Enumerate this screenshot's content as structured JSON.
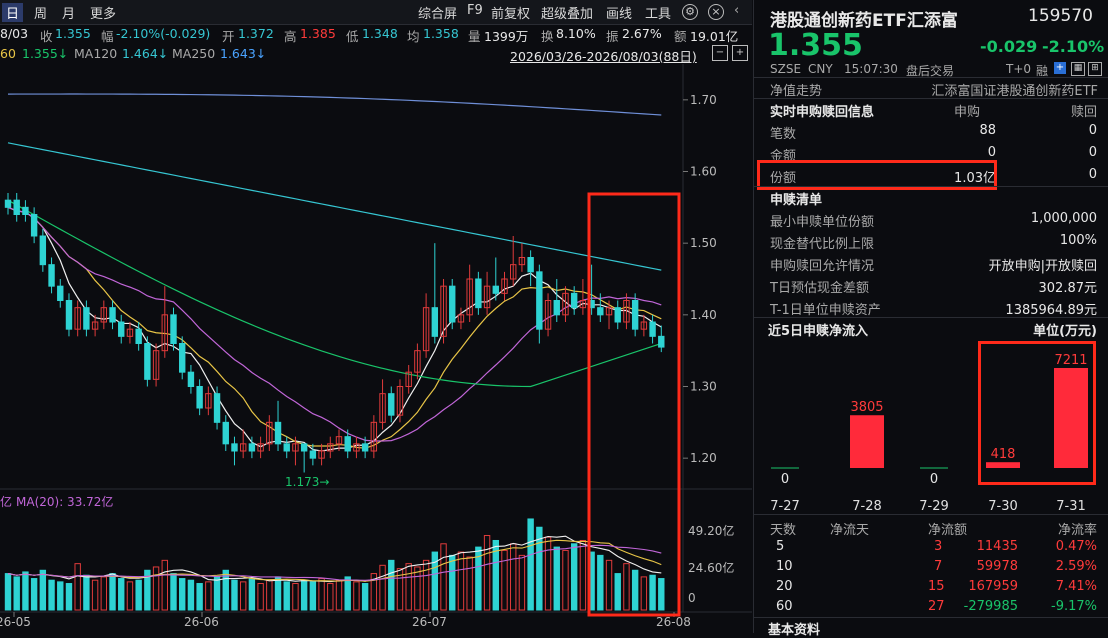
{
  "toolbar": {
    "period_day": "日",
    "period_week": "周",
    "period_month": "月",
    "more": "更多",
    "composite": "综合屏",
    "f9": "F9",
    "adjust": "前复权",
    "overlay": "超级叠加",
    "draw": "画线",
    "tools": "工具"
  },
  "infobar": {
    "date": "8/03",
    "close_label": "收",
    "close": "1.355",
    "change_label": "幅",
    "change": "-2.10%(-0.029)",
    "open_label": "开",
    "open": "1.372",
    "high_label": "高",
    "high": "1.385",
    "low_label": "低",
    "low": "1.348",
    "avg_label": "均",
    "avg": "1.358",
    "volume_label": "量",
    "volume": "1399万",
    "turnover_label": "换",
    "turnover": "8.10%",
    "amplitude_label": "振",
    "amplitude": "2.67%",
    "amount_label": "额",
    "amount": "19.01亿"
  },
  "mabar": {
    "ma60_prefix": "60",
    "ma60": "1.355↓",
    "ma120_label": "MA120",
    "ma120": "1.464↓",
    "ma250_label": "MA250",
    "ma250": "1.643↓",
    "range": "2026/03/26-2026/08/03(88日)"
  },
  "chart_data": {
    "type": "candlestick",
    "price_axis": [
      "1.70",
      "1.60",
      "1.50",
      "1.40",
      "1.30",
      "1.20"
    ],
    "low_marker": "1.173",
    "volume_label": "亿",
    "volume_ma": "MA(20): 33.72亿",
    "volume_axis": [
      "49.20亿",
      "24.60亿",
      "0"
    ],
    "x_labels": [
      "26-05",
      "26-06",
      "26-07",
      "26-08"
    ],
    "candles": [
      {
        "o": 1.56,
        "c": 1.55,
        "h": 1.57,
        "l": 1.54
      },
      {
        "o": 1.56,
        "c": 1.54,
        "h": 1.57,
        "l": 1.53
      },
      {
        "o": 1.55,
        "c": 1.54,
        "h": 1.56,
        "l": 1.53
      },
      {
        "o": 1.54,
        "c": 1.51,
        "h": 1.55,
        "l": 1.5
      },
      {
        "o": 1.51,
        "c": 1.47,
        "h": 1.52,
        "l": 1.46
      },
      {
        "o": 1.47,
        "c": 1.44,
        "h": 1.48,
        "l": 1.43
      },
      {
        "o": 1.44,
        "c": 1.42,
        "h": 1.45,
        "l": 1.41
      },
      {
        "o": 1.42,
        "c": 1.38,
        "h": 1.43,
        "l": 1.37
      },
      {
        "o": 1.38,
        "c": 1.41,
        "h": 1.42,
        "l": 1.37
      },
      {
        "o": 1.41,
        "c": 1.38,
        "h": 1.42,
        "l": 1.37
      },
      {
        "o": 1.38,
        "c": 1.39,
        "h": 1.4,
        "l": 1.37
      },
      {
        "o": 1.39,
        "c": 1.41,
        "h": 1.42,
        "l": 1.38
      },
      {
        "o": 1.41,
        "c": 1.39,
        "h": 1.42,
        "l": 1.38
      },
      {
        "o": 1.39,
        "c": 1.37,
        "h": 1.4,
        "l": 1.36
      },
      {
        "o": 1.37,
        "c": 1.38,
        "h": 1.39,
        "l": 1.36
      },
      {
        "o": 1.38,
        "c": 1.36,
        "h": 1.39,
        "l": 1.35
      },
      {
        "o": 1.36,
        "c": 1.31,
        "h": 1.37,
        "l": 1.3
      },
      {
        "o": 1.31,
        "c": 1.35,
        "h": 1.36,
        "l": 1.3
      },
      {
        "o": 1.35,
        "c": 1.4,
        "h": 1.44,
        "l": 1.34
      },
      {
        "o": 1.4,
        "c": 1.36,
        "h": 1.41,
        "l": 1.35
      },
      {
        "o": 1.36,
        "c": 1.32,
        "h": 1.37,
        "l": 1.31
      },
      {
        "o": 1.32,
        "c": 1.3,
        "h": 1.33,
        "l": 1.29
      },
      {
        "o": 1.3,
        "c": 1.27,
        "h": 1.31,
        "l": 1.26
      },
      {
        "o": 1.27,
        "c": 1.29,
        "h": 1.3,
        "l": 1.26
      },
      {
        "o": 1.29,
        "c": 1.25,
        "h": 1.3,
        "l": 1.24
      },
      {
        "o": 1.25,
        "c": 1.22,
        "h": 1.26,
        "l": 1.21
      },
      {
        "o": 1.22,
        "c": 1.21,
        "h": 1.23,
        "l": 1.19
      },
      {
        "o": 1.21,
        "c": 1.22,
        "h": 1.24,
        "l": 1.2
      },
      {
        "o": 1.22,
        "c": 1.21,
        "h": 1.23,
        "l": 1.2
      },
      {
        "o": 1.21,
        "c": 1.22,
        "h": 1.23,
        "l": 1.2
      },
      {
        "o": 1.22,
        "c": 1.25,
        "h": 1.26,
        "l": 1.21
      },
      {
        "o": 1.25,
        "c": 1.22,
        "h": 1.28,
        "l": 1.21
      },
      {
        "o": 1.22,
        "c": 1.21,
        "h": 1.23,
        "l": 1.2
      },
      {
        "o": 1.21,
        "c": 1.22,
        "h": 1.23,
        "l": 1.19
      },
      {
        "o": 1.22,
        "c": 1.21,
        "h": 1.22,
        "l": 1.18
      },
      {
        "o": 1.21,
        "c": 1.2,
        "h": 1.22,
        "l": 1.19
      },
      {
        "o": 1.2,
        "c": 1.21,
        "h": 1.22,
        "l": 1.19
      },
      {
        "o": 1.21,
        "c": 1.22,
        "h": 1.23,
        "l": 1.2
      },
      {
        "o": 1.22,
        "c": 1.23,
        "h": 1.24,
        "l": 1.21
      },
      {
        "o": 1.23,
        "c": 1.21,
        "h": 1.24,
        "l": 1.2
      },
      {
        "o": 1.21,
        "c": 1.22,
        "h": 1.23,
        "l": 1.2
      },
      {
        "o": 1.22,
        "c": 1.21,
        "h": 1.23,
        "l": 1.2
      },
      {
        "o": 1.21,
        "c": 1.25,
        "h": 1.26,
        "l": 1.2
      },
      {
        "o": 1.25,
        "c": 1.29,
        "h": 1.31,
        "l": 1.24
      },
      {
        "o": 1.29,
        "c": 1.26,
        "h": 1.3,
        "l": 1.25
      },
      {
        "o": 1.26,
        "c": 1.3,
        "h": 1.31,
        "l": 1.25
      },
      {
        "o": 1.3,
        "c": 1.32,
        "h": 1.33,
        "l": 1.29
      },
      {
        "o": 1.32,
        "c": 1.35,
        "h": 1.36,
        "l": 1.31
      },
      {
        "o": 1.35,
        "c": 1.41,
        "h": 1.43,
        "l": 1.34
      },
      {
        "o": 1.41,
        "c": 1.37,
        "h": 1.5,
        "l": 1.36
      },
      {
        "o": 1.37,
        "c": 1.44,
        "h": 1.45,
        "l": 1.36
      },
      {
        "o": 1.44,
        "c": 1.39,
        "h": 1.45,
        "l": 1.38
      },
      {
        "o": 1.39,
        "c": 1.4,
        "h": 1.41,
        "l": 1.38
      },
      {
        "o": 1.4,
        "c": 1.45,
        "h": 1.47,
        "l": 1.39
      },
      {
        "o": 1.45,
        "c": 1.41,
        "h": 1.46,
        "l": 1.4
      },
      {
        "o": 1.41,
        "c": 1.44,
        "h": 1.46,
        "l": 1.4
      },
      {
        "o": 1.44,
        "c": 1.43,
        "h": 1.48,
        "l": 1.42
      },
      {
        "o": 1.43,
        "c": 1.45,
        "h": 1.46,
        "l": 1.42
      },
      {
        "o": 1.45,
        "c": 1.47,
        "h": 1.51,
        "l": 1.44
      },
      {
        "o": 1.47,
        "c": 1.48,
        "h": 1.5,
        "l": 1.46
      },
      {
        "o": 1.48,
        "c": 1.46,
        "h": 1.49,
        "l": 1.44
      },
      {
        "o": 1.46,
        "c": 1.38,
        "h": 1.47,
        "l": 1.36
      },
      {
        "o": 1.38,
        "c": 1.42,
        "h": 1.43,
        "l": 1.37
      },
      {
        "o": 1.42,
        "c": 1.4,
        "h": 1.45,
        "l": 1.39
      },
      {
        "o": 1.4,
        "c": 1.43,
        "h": 1.44,
        "l": 1.39
      },
      {
        "o": 1.43,
        "c": 1.41,
        "h": 1.44,
        "l": 1.4
      },
      {
        "o": 1.41,
        "c": 1.42,
        "h": 1.45,
        "l": 1.4
      },
      {
        "o": 1.42,
        "c": 1.41,
        "h": 1.47,
        "l": 1.4
      },
      {
        "o": 1.41,
        "c": 1.4,
        "h": 1.43,
        "l": 1.39
      },
      {
        "o": 1.4,
        "c": 1.41,
        "h": 1.42,
        "l": 1.38
      },
      {
        "o": 1.41,
        "c": 1.39,
        "h": 1.42,
        "l": 1.38
      },
      {
        "o": 1.39,
        "c": 1.42,
        "h": 1.43,
        "l": 1.38
      },
      {
        "o": 1.42,
        "c": 1.38,
        "h": 1.43,
        "l": 1.37
      },
      {
        "o": 1.38,
        "c": 1.39,
        "h": 1.4,
        "l": 1.37
      },
      {
        "o": 1.39,
        "c": 1.37,
        "h": 1.4,
        "l": 1.36
      },
      {
        "o": 1.37,
        "c": 1.355,
        "h": 1.385,
        "l": 1.348
      }
    ]
  },
  "panel": {
    "title": "港股通创新药ETF汇添富",
    "code": "159570",
    "price": "1.355",
    "change": "-0.029",
    "change_pct": "-2.10%",
    "market": "SZSE",
    "currency": "CNY",
    "time": "15:07:30",
    "session": "盘后交易",
    "t0": "T+0",
    "margin": "融",
    "nav_label": "净值走势",
    "nav_value": "汇添富国证港股通创新药ETF",
    "rt_title": "实时申购赎回信息",
    "col_sub": "申购",
    "col_red": "赎回",
    "rows": [
      {
        "label": "笔数",
        "sub": "88",
        "red": "0"
      },
      {
        "label": "金额",
        "sub": "0",
        "red": "0"
      },
      {
        "label": "份额",
        "sub": "1.03亿",
        "red": "0"
      }
    ],
    "list_title": "申赎清单",
    "list": [
      {
        "label": "最小申赎单位份额",
        "value": "1,000,000"
      },
      {
        "label": "现金替代比例上限",
        "value": "100%"
      },
      {
        "label": "申购赎回允许情况",
        "value": "开放申购|开放赎回"
      },
      {
        "label": "T日预估现金差额",
        "value": "302.87元"
      },
      {
        "label": "T-1日单位申赎资产",
        "value": "1385964.89元"
      }
    ],
    "flow_title": "近5日申赎净流入",
    "flow_unit": "单位(万元)",
    "flow_chart": {
      "type": "bar",
      "categories": [
        "7-27",
        "7-28",
        "7-29",
        "7-30",
        "7-31"
      ],
      "values": [
        0,
        3805,
        0,
        418,
        7211
      ],
      "labels": [
        "0",
        "3805",
        "0",
        "418",
        "7211"
      ]
    },
    "stats_headers": [
      "天数",
      "净流天",
      "净流额",
      "净流率"
    ],
    "stats": [
      {
        "days": "5",
        "flow_days": "3",
        "amount": "11435",
        "rate": "0.47%"
      },
      {
        "days": "10",
        "flow_days": "7",
        "amount": "59978",
        "rate": "2.59%"
      },
      {
        "days": "20",
        "flow_days": "15",
        "amount": "167959",
        "rate": "7.41%"
      },
      {
        "days": "60",
        "flow_days": "27",
        "amount": "-279985",
        "rate": "-9.17%"
      }
    ],
    "basic_title": "基本资料"
  },
  "colors": {
    "up": "#e03b3b",
    "down": "#2ed3d3",
    "highlight": "#ff2a1a",
    "ma5": "#f0f0f0",
    "ma10": "#e8c547",
    "ma20": "#c166d8",
    "ma60": "#19c46a",
    "ma120": "#36c6d2"
  }
}
